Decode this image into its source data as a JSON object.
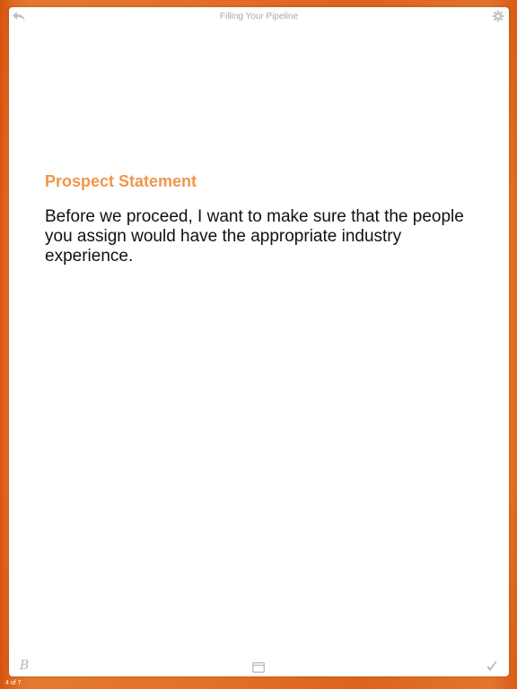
{
  "header": {
    "title": "Filling Your Pipeline",
    "back_icon": "back-arrow-icon",
    "settings_icon": "gear-icon"
  },
  "card": {
    "heading": "Prospect Statement",
    "statement": "Before we proceed, I want to make sure that the people you assign would have the appropriate industry experience."
  },
  "footer": {
    "script_label": "B",
    "layout_icon": "window-icon",
    "done_icon": "checkmark-icon"
  },
  "pager": {
    "label": "4 of 7"
  },
  "colors": {
    "accent": "#f0964a",
    "background": "#f39144",
    "icon": "#b5b5b5"
  }
}
